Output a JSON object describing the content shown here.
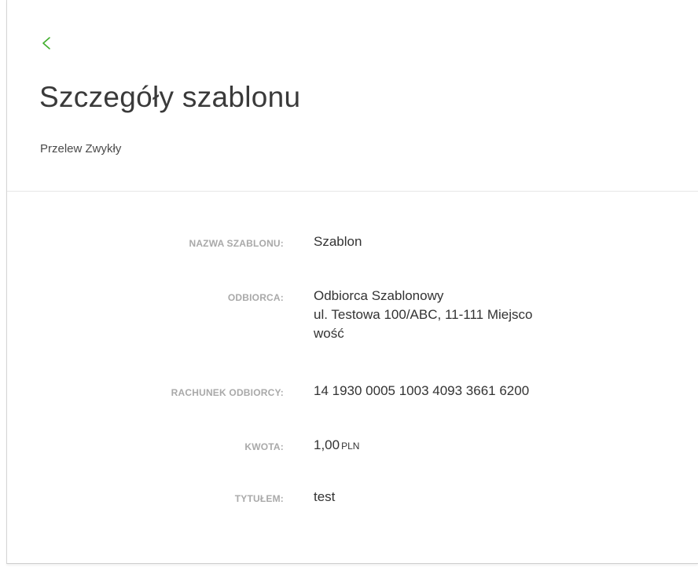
{
  "header": {
    "back_icon": "chevron-left-icon",
    "accent_color": "#3fae2a",
    "title": "Szczegóły szablonu",
    "subtitle": "Przelew Zwykły"
  },
  "details": {
    "template_name": {
      "label": "NAZWA SZABLONU:",
      "value": "Szablon"
    },
    "recipient": {
      "label": "ODBIORCA:",
      "name": "Odbiorca Szablonowy",
      "address_line1": "ul. Testowa 100/ABC, 11-111 Miejsco",
      "address_line2": "wość"
    },
    "recipient_account": {
      "label": "RACHUNEK ODBIORCY:",
      "value": "14 1930 0005 1003 4093 3661 6200"
    },
    "amount": {
      "label": "KWOTA:",
      "value": "1,00",
      "currency": "PLN"
    },
    "title": {
      "label": "TYTUŁEM:",
      "value": "test"
    }
  }
}
